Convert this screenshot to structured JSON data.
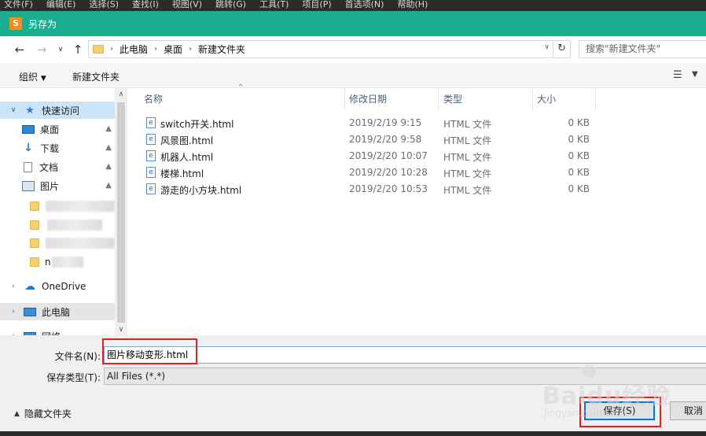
{
  "editor_menu": [
    "文件(F)",
    "编辑(E)",
    "选择(S)",
    "查找(I)",
    "视图(V)",
    "跳转(G)",
    "工具(T)",
    "项目(P)",
    "首选项(N)",
    "帮助(H)"
  ],
  "dialog": {
    "title": "另存为",
    "app_logo": "S",
    "accent_color": "#1aad8f"
  },
  "address": {
    "crumbs": [
      "此电脑",
      "桌面",
      "新建文件夹"
    ],
    "search_placeholder": "搜索\"新建文件夹\""
  },
  "toolbar": {
    "organize_label": "组织",
    "new_folder_label": "新建文件夹"
  },
  "nav": {
    "quick_access": "快速访问",
    "desktop": "桌面",
    "downloads": "下载",
    "documents": "文档",
    "pictures": "图片",
    "folder_partial": "n",
    "onedrive": "OneDrive",
    "this_pc": "此电脑",
    "network": "网络"
  },
  "columns": {
    "name": "名称",
    "date": "修改日期",
    "type": "类型",
    "size": "大小"
  },
  "files": [
    {
      "name": "switch开关.html",
      "date": "2019/2/19 9:15",
      "type": "HTML 文件",
      "size": "0 KB"
    },
    {
      "name": "风景图.html",
      "date": "2019/2/20 9:58",
      "type": "HTML 文件",
      "size": "0 KB"
    },
    {
      "name": "机器人.html",
      "date": "2019/2/20 10:07",
      "type": "HTML 文件",
      "size": "0 KB"
    },
    {
      "name": "楼梯.html",
      "date": "2019/2/20 10:28",
      "type": "HTML 文件",
      "size": "0 KB"
    },
    {
      "name": "游走的小方块.html",
      "date": "2019/2/20 10:53",
      "type": "HTML 文件",
      "size": "0 KB"
    }
  ],
  "form": {
    "filename_label": "文件名(N):",
    "filename_value": "图片移动变形.html",
    "filetype_label": "保存类型(T):",
    "filetype_value": "All Files (*.*)",
    "hide_folders_label": "隐藏文件夹",
    "save_label": "保存(S)",
    "cancel_label": "取消"
  },
  "watermark": {
    "main": "Baidu经验",
    "sub": "jingyan.baidu.com"
  }
}
